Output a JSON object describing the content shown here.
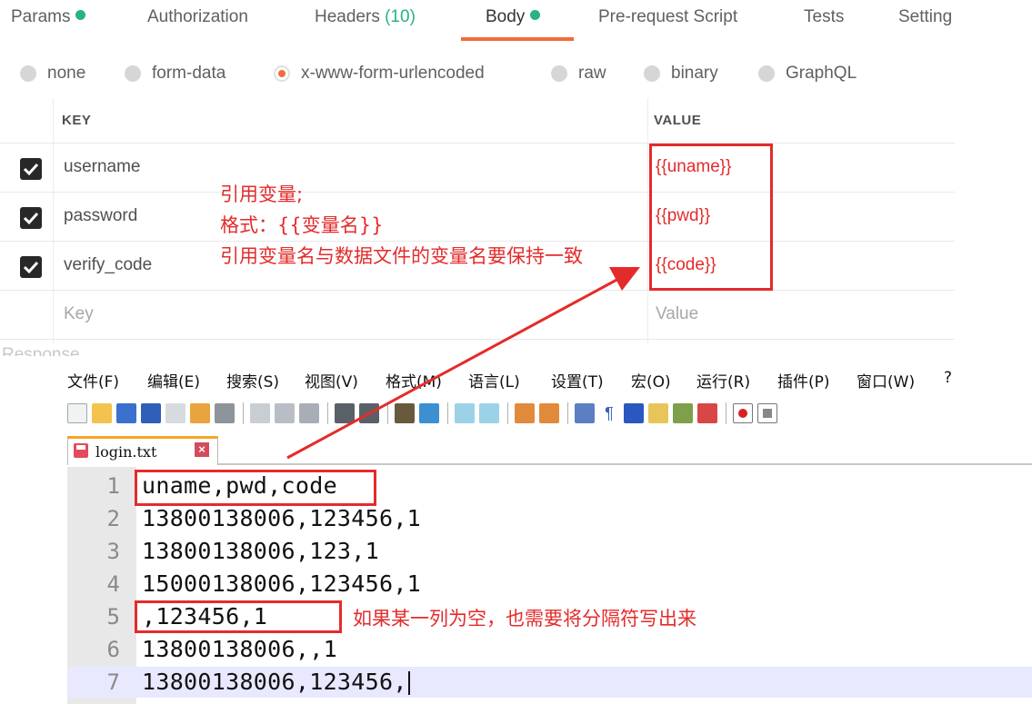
{
  "postman": {
    "tabs": [
      {
        "label": "Params",
        "dot": true
      },
      {
        "label": "Authorization"
      },
      {
        "label": "Headers",
        "count": "(10)"
      },
      {
        "label": "Body",
        "dot": true,
        "active": true
      },
      {
        "label": "Pre-request Script"
      },
      {
        "label": "Tests"
      },
      {
        "label": "Setting"
      }
    ],
    "body_types": [
      "none",
      "form-data",
      "x-www-form-urlencoded",
      "raw",
      "binary",
      "GraphQL"
    ],
    "selected_body_type": "x-www-form-urlencoded",
    "table": {
      "key_header": "KEY",
      "value_header": "VALUE",
      "rows": [
        {
          "key": "username",
          "value": "{{uname}}",
          "checked": true
        },
        {
          "key": "password",
          "value": "{{pwd}}",
          "checked": true
        },
        {
          "key": "verify_code",
          "value": "{{code}}",
          "checked": true
        }
      ],
      "placeholder_key": "Key",
      "placeholder_value": "Value"
    },
    "response_label": "Response"
  },
  "annotations": {
    "line1": "引用变量;",
    "line2": "格式：{{变量名}}",
    "line3": "引用变量名与数据文件的变量名要保持一致",
    "empty_column": "如果某一列为空，也需要将分隔符写出来"
  },
  "notepad": {
    "menu": [
      "文件(F)",
      "编辑(E)",
      "搜索(S)",
      "视图(V)",
      "格式(M)",
      "语言(L)",
      "设置(T)",
      "宏(O)",
      "运行(R)",
      "插件(P)",
      "窗口(W)",
      "?"
    ],
    "file_tab": "login.txt",
    "lines": [
      {
        "num": "1",
        "text": "uname,pwd,code"
      },
      {
        "num": "2",
        "text": "13800138006,123456,1"
      },
      {
        "num": "3",
        "text": "13800138006,123,1"
      },
      {
        "num": "4",
        "text": "15000138006,123456,1"
      },
      {
        "num": "5",
        "text": ",123456,1"
      },
      {
        "num": "6",
        "text": "13800138006,,1"
      },
      {
        "num": "7",
        "text": "13800138006,123456,"
      }
    ]
  },
  "colors": {
    "accent_orange": "#f26b3a",
    "green_dot": "#26b47f",
    "annotation_red": "#e42b2b"
  }
}
